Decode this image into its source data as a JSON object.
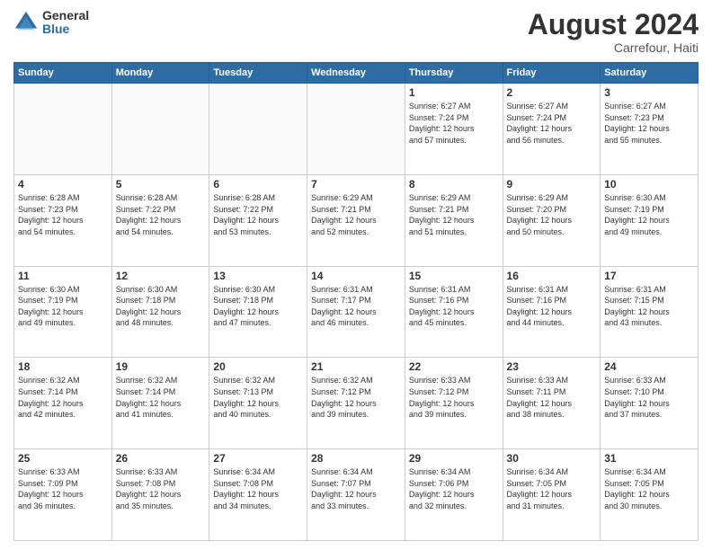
{
  "logo": {
    "general": "General",
    "blue": "Blue"
  },
  "title": "August 2024",
  "subtitle": "Carrefour, Haiti",
  "days_header": [
    "Sunday",
    "Monday",
    "Tuesday",
    "Wednesday",
    "Thursday",
    "Friday",
    "Saturday"
  ],
  "weeks": [
    [
      {
        "day": "",
        "info": ""
      },
      {
        "day": "",
        "info": ""
      },
      {
        "day": "",
        "info": ""
      },
      {
        "day": "",
        "info": ""
      },
      {
        "day": "1",
        "info": "Sunrise: 6:27 AM\nSunset: 7:24 PM\nDaylight: 12 hours\nand 57 minutes."
      },
      {
        "day": "2",
        "info": "Sunrise: 6:27 AM\nSunset: 7:24 PM\nDaylight: 12 hours\nand 56 minutes."
      },
      {
        "day": "3",
        "info": "Sunrise: 6:27 AM\nSunset: 7:23 PM\nDaylight: 12 hours\nand 55 minutes."
      }
    ],
    [
      {
        "day": "4",
        "info": "Sunrise: 6:28 AM\nSunset: 7:23 PM\nDaylight: 12 hours\nand 54 minutes."
      },
      {
        "day": "5",
        "info": "Sunrise: 6:28 AM\nSunset: 7:22 PM\nDaylight: 12 hours\nand 54 minutes."
      },
      {
        "day": "6",
        "info": "Sunrise: 6:28 AM\nSunset: 7:22 PM\nDaylight: 12 hours\nand 53 minutes."
      },
      {
        "day": "7",
        "info": "Sunrise: 6:29 AM\nSunset: 7:21 PM\nDaylight: 12 hours\nand 52 minutes."
      },
      {
        "day": "8",
        "info": "Sunrise: 6:29 AM\nSunset: 7:21 PM\nDaylight: 12 hours\nand 51 minutes."
      },
      {
        "day": "9",
        "info": "Sunrise: 6:29 AM\nSunset: 7:20 PM\nDaylight: 12 hours\nand 50 minutes."
      },
      {
        "day": "10",
        "info": "Sunrise: 6:30 AM\nSunset: 7:19 PM\nDaylight: 12 hours\nand 49 minutes."
      }
    ],
    [
      {
        "day": "11",
        "info": "Sunrise: 6:30 AM\nSunset: 7:19 PM\nDaylight: 12 hours\nand 49 minutes."
      },
      {
        "day": "12",
        "info": "Sunrise: 6:30 AM\nSunset: 7:18 PM\nDaylight: 12 hours\nand 48 minutes."
      },
      {
        "day": "13",
        "info": "Sunrise: 6:30 AM\nSunset: 7:18 PM\nDaylight: 12 hours\nand 47 minutes."
      },
      {
        "day": "14",
        "info": "Sunrise: 6:31 AM\nSunset: 7:17 PM\nDaylight: 12 hours\nand 46 minutes."
      },
      {
        "day": "15",
        "info": "Sunrise: 6:31 AM\nSunset: 7:16 PM\nDaylight: 12 hours\nand 45 minutes."
      },
      {
        "day": "16",
        "info": "Sunrise: 6:31 AM\nSunset: 7:16 PM\nDaylight: 12 hours\nand 44 minutes."
      },
      {
        "day": "17",
        "info": "Sunrise: 6:31 AM\nSunset: 7:15 PM\nDaylight: 12 hours\nand 43 minutes."
      }
    ],
    [
      {
        "day": "18",
        "info": "Sunrise: 6:32 AM\nSunset: 7:14 PM\nDaylight: 12 hours\nand 42 minutes."
      },
      {
        "day": "19",
        "info": "Sunrise: 6:32 AM\nSunset: 7:14 PM\nDaylight: 12 hours\nand 41 minutes."
      },
      {
        "day": "20",
        "info": "Sunrise: 6:32 AM\nSunset: 7:13 PM\nDaylight: 12 hours\nand 40 minutes."
      },
      {
        "day": "21",
        "info": "Sunrise: 6:32 AM\nSunset: 7:12 PM\nDaylight: 12 hours\nand 39 minutes."
      },
      {
        "day": "22",
        "info": "Sunrise: 6:33 AM\nSunset: 7:12 PM\nDaylight: 12 hours\nand 39 minutes."
      },
      {
        "day": "23",
        "info": "Sunrise: 6:33 AM\nSunset: 7:11 PM\nDaylight: 12 hours\nand 38 minutes."
      },
      {
        "day": "24",
        "info": "Sunrise: 6:33 AM\nSunset: 7:10 PM\nDaylight: 12 hours\nand 37 minutes."
      }
    ],
    [
      {
        "day": "25",
        "info": "Sunrise: 6:33 AM\nSunset: 7:09 PM\nDaylight: 12 hours\nand 36 minutes."
      },
      {
        "day": "26",
        "info": "Sunrise: 6:33 AM\nSunset: 7:08 PM\nDaylight: 12 hours\nand 35 minutes."
      },
      {
        "day": "27",
        "info": "Sunrise: 6:34 AM\nSunset: 7:08 PM\nDaylight: 12 hours\nand 34 minutes."
      },
      {
        "day": "28",
        "info": "Sunrise: 6:34 AM\nSunset: 7:07 PM\nDaylight: 12 hours\nand 33 minutes."
      },
      {
        "day": "29",
        "info": "Sunrise: 6:34 AM\nSunset: 7:06 PM\nDaylight: 12 hours\nand 32 minutes."
      },
      {
        "day": "30",
        "info": "Sunrise: 6:34 AM\nSunset: 7:05 PM\nDaylight: 12 hours\nand 31 minutes."
      },
      {
        "day": "31",
        "info": "Sunrise: 6:34 AM\nSunset: 7:05 PM\nDaylight: 12 hours\nand 30 minutes."
      }
    ]
  ]
}
